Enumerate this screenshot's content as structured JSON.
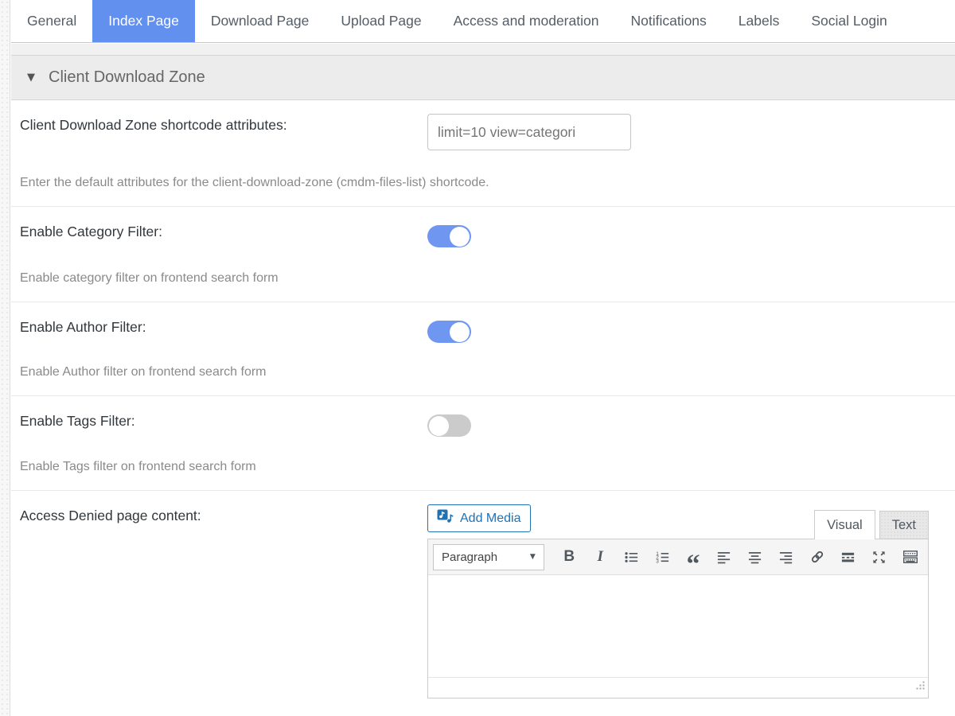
{
  "tabs": {
    "items": [
      {
        "label": "General",
        "active": false
      },
      {
        "label": "Index Page",
        "active": true
      },
      {
        "label": "Download Page",
        "active": false
      },
      {
        "label": "Upload Page",
        "active": false
      },
      {
        "label": "Access and moderation",
        "active": false
      },
      {
        "label": "Notifications",
        "active": false
      },
      {
        "label": "Labels",
        "active": false
      },
      {
        "label": "Social Login",
        "active": false
      }
    ]
  },
  "section": {
    "title": "Client Download Zone",
    "collapse_icon": "▼"
  },
  "rows": [
    {
      "label": "Client Download Zone shortcode attributes:",
      "value": "limit=10 view=categori",
      "help": "Enter the default attributes for the client-download-zone (cmdm-files-list) shortcode."
    },
    {
      "label": "Enable Category Filter:",
      "state": "on",
      "help": "Enable category filter on frontend search form"
    },
    {
      "label": "Enable Author Filter:",
      "state": "on",
      "help": "Enable Author filter on frontend search form"
    },
    {
      "label": "Enable Tags Filter:",
      "state": "off",
      "help": "Enable Tags filter on frontend search form"
    },
    {
      "label": "Access Denied page content:"
    }
  ],
  "editor": {
    "add_media_label": "Add Media",
    "tabs": {
      "visual": "Visual",
      "text": "Text"
    },
    "toolbar": {
      "paragraph_label": "Paragraph",
      "dropdown_arrow": "▼",
      "bold_glyph": "B",
      "italic_glyph": "I",
      "blockquote_glyph": "“",
      "icons": [
        "bold",
        "italic",
        "bullet-list",
        "numbered-list",
        "blockquote",
        "align-left",
        "align-center",
        "align-right",
        "link",
        "read-more",
        "fullscreen",
        "keyboard"
      ]
    },
    "content": ""
  },
  "colors": {
    "active_tab_blue": "#6290ee",
    "toggle_on_blue": "#6f96f0",
    "toggle_off_gray": "#cbcbcb",
    "wp_link_blue": "#2271b1",
    "section_header_bg": "#ececec",
    "toolbar_bg": "#f5f5f5"
  }
}
